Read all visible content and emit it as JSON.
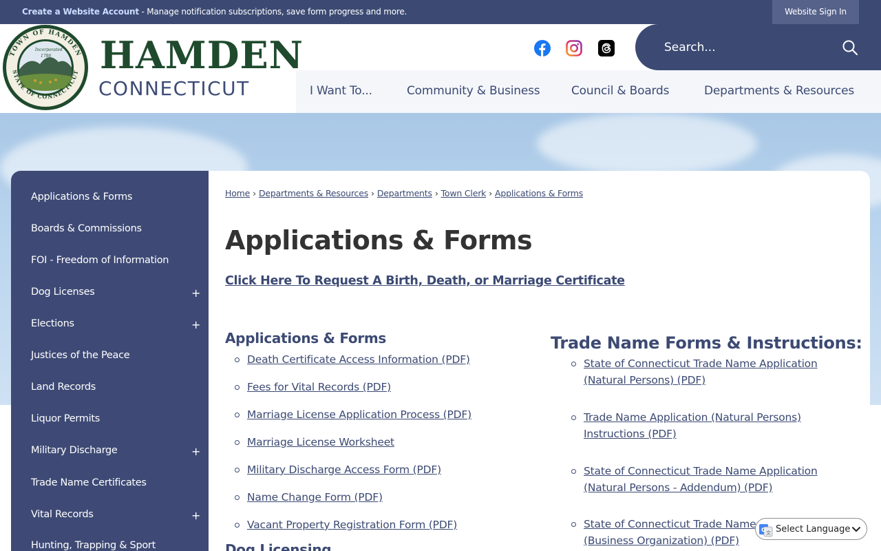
{
  "topbar": {
    "create_account": "Create a Website Account",
    "create_account_rest": " - Manage notification subscriptions, save form progress and more.",
    "sign_in": "Website Sign In"
  },
  "header": {
    "brand_line1": "HAMDEN",
    "brand_line2": "CONNECTICUT",
    "seal_text_top": "TOWN OF HAMDEN",
    "seal_text_bottom": "STATE OF CONNECTICUT",
    "seal_incorporated": "Incorporated",
    "seal_year": "1786",
    "search_placeholder": "Search...",
    "social": [
      "facebook-icon",
      "instagram-icon",
      "threads-icon"
    ],
    "nav": [
      {
        "label": "I Want To..."
      },
      {
        "label": "Community & Business"
      },
      {
        "label": "Council & Boards"
      },
      {
        "label": "Departments & Resources"
      }
    ]
  },
  "sidebar": {
    "items": [
      {
        "label": "Applications & Forms",
        "expandable": false
      },
      {
        "label": "Boards & Commissions",
        "expandable": false
      },
      {
        "label": "FOI - Freedom of Information",
        "expandable": false
      },
      {
        "label": "Dog Licenses",
        "expandable": true
      },
      {
        "label": "Elections",
        "expandable": true
      },
      {
        "label": "Justices of the Peace",
        "expandable": false
      },
      {
        "label": "Land Records",
        "expandable": false
      },
      {
        "label": "Liquor Permits",
        "expandable": false
      },
      {
        "label": "Military Discharge",
        "expandable": true
      },
      {
        "label": "Trade Name Certificates",
        "expandable": false
      },
      {
        "label": "Vital Records",
        "expandable": true
      },
      {
        "label": "Hunting, Trapping & Sport",
        "expandable": false
      }
    ],
    "expand_symbol": "+"
  },
  "breadcrumb": {
    "items": [
      "Home",
      "Departments & Resources",
      "Departments",
      "Town Clerk",
      "Applications & Forms"
    ],
    "separator": "›"
  },
  "main": {
    "title": "Applications & Forms",
    "request_link": "Click Here To Request A Birth, Death, or Marriage Certificate",
    "left_heading": "Applications & Forms",
    "left_links": [
      "Death Certificate Access Information (PDF)",
      "Fees for Vital Records (PDF)",
      "Marriage License Application Process (PDF)",
      "Marriage License Worksheet",
      "Military Discharge Access Form (PDF)",
      "Name Change Form (PDF)",
      "Vacant Property Registration Form (PDF)"
    ],
    "next_heading": "Dog Licensing",
    "right_heading": "Trade Name Forms & Instructions:",
    "right_links": [
      {
        "line1": "State of Connecticut Trade Name Application",
        "line2": "(Natural Persons) (PDF)"
      },
      {
        "line1": "Trade Name Application (Natural Persons)",
        "line2": "Instructions (PDF)"
      },
      {
        "line1": "State of Connecticut Trade Name Application",
        "line2": "(Natural Persons - Addendum) (PDF)"
      },
      {
        "line1": "State of Connecticut Trade Name",
        "line2": "(Business Organization) (PDF)"
      }
    ]
  },
  "translate": {
    "label": "Select Language"
  },
  "colors": {
    "navy": "#3c4a73",
    "brand_green": "#1f4a2d",
    "link_light": "#c9dcff"
  }
}
